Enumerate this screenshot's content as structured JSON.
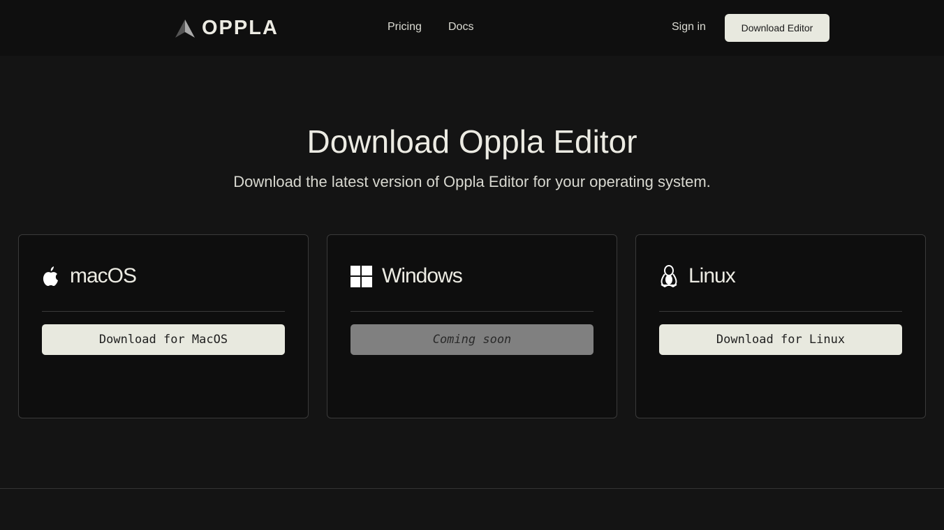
{
  "nav": {
    "brand": "OPPLA",
    "links": [
      "Pricing",
      "Docs"
    ],
    "sign_in": "Sign in",
    "download": "Download Editor"
  },
  "hero": {
    "title": "Download Oppla Editor",
    "subtitle": "Download the latest version of Oppla Editor for your operating system."
  },
  "cards": [
    {
      "os": "macOS",
      "icon": "apple-icon",
      "button": "Download for MacOS",
      "enabled": true
    },
    {
      "os": "Windows",
      "icon": "windows-icon",
      "button": "Coming soon",
      "enabled": false
    },
    {
      "os": "Linux",
      "icon": "linux-penguin-icon",
      "button": "Download for Linux",
      "enabled": true
    }
  ]
}
